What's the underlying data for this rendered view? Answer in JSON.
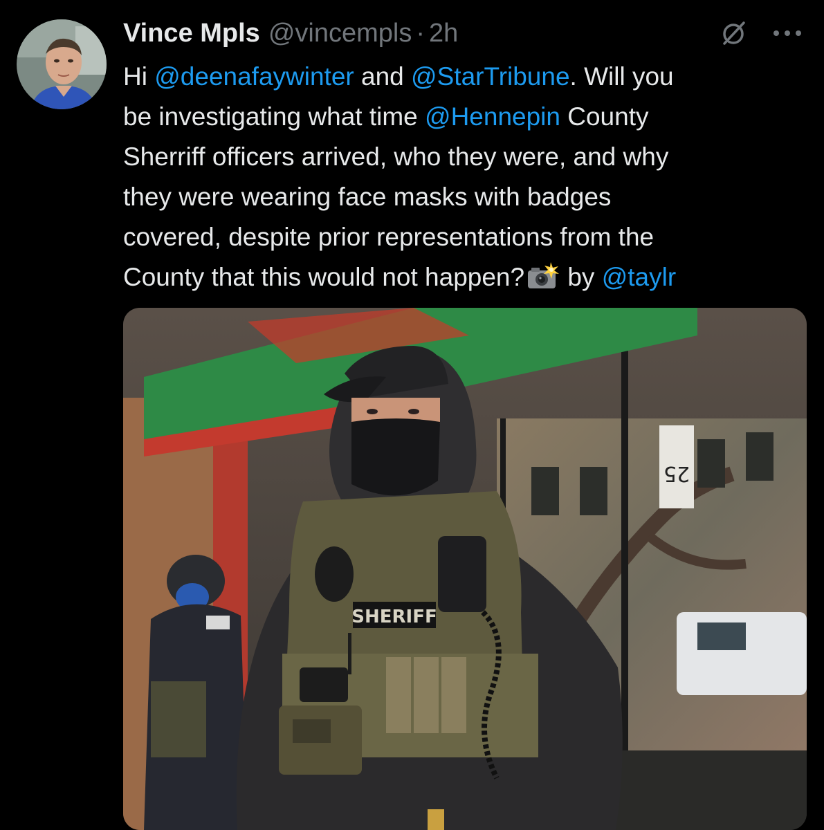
{
  "tweet": {
    "author": {
      "display_name": "Vince Mpls",
      "handle": "@vincempls",
      "avatar": "avatar-photo"
    },
    "separator": "·",
    "timestamp": "2h",
    "icons": {
      "grok": "grok-icon",
      "more": "more-options-icon"
    },
    "text": {
      "line1_prefix": "Hi ",
      "mention1": "@deenafaywinter",
      "line1_mid": " and ",
      "mention2": "@StarTribune",
      "line1_suffix": ". Will you",
      "line2_prefix": "be investigating what time ",
      "mention3": "@Hennepin",
      "line2_suffix": " County",
      "line3": "Sherriff officers arrived, who they were, and why",
      "line4": "they were wearing face masks with badges",
      "line5": "covered, despite prior representations from the",
      "line6_prefix": "County that this would not happen?",
      "emoji": "camera-with-flash",
      "line6_mid": " by ",
      "mention4": "@taylr"
    },
    "media": {
      "type": "photo",
      "vest_text": "SHERIFF",
      "sign_text": "25"
    },
    "colors": {
      "background": "#000000",
      "text": "#e7e9ea",
      "secondary": "#71767b",
      "link": "#1d9bf0"
    }
  }
}
